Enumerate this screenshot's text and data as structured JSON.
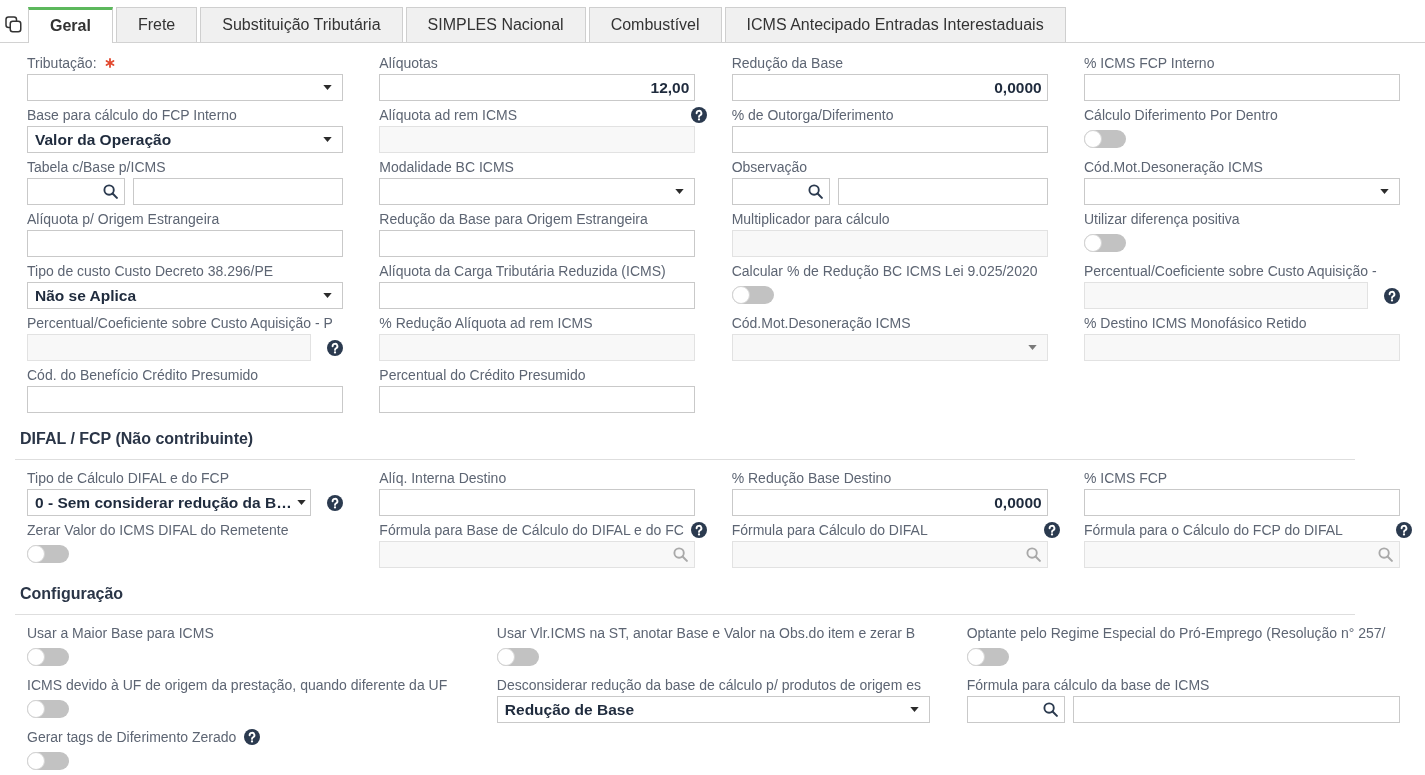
{
  "tabs": [
    {
      "label": "Geral",
      "selected": true
    },
    {
      "label": "Frete",
      "selected": false
    },
    {
      "label": "Substituição Tributária",
      "selected": false
    },
    {
      "label": "SIMPLES Nacional",
      "selected": false
    },
    {
      "label": "Combustível",
      "selected": false
    },
    {
      "label": "ICMS Antecipado Entradas Interestaduais",
      "selected": false
    }
  ],
  "fields": [
    {
      "label": "Tributação:",
      "kind": "select",
      "required": true,
      "disabled": false,
      "help": false
    },
    {
      "label": "Alíquotas",
      "kind": "text",
      "value": "12,00",
      "disabled": false,
      "help": false
    },
    {
      "label": "Redução da Base",
      "kind": "text",
      "value": "0,0000",
      "disabled": false,
      "help": false
    },
    {
      "label": "% ICMS FCP Interno",
      "kind": "text",
      "disabled": false,
      "help": false
    },
    {
      "label": "Base para cálculo do FCP Interno",
      "kind": "select",
      "value": "Valor da Operação",
      "disabled": false,
      "help": false
    },
    {
      "label": "Alíquota ad rem ICMS",
      "kind": "text",
      "disabled": true,
      "help": true
    },
    {
      "label": "% de Outorga/Diferimento",
      "kind": "text",
      "disabled": false,
      "help": false
    },
    {
      "label": "Cálculo Diferimento Por Dentro",
      "kind": "toggle",
      "on": false,
      "help": false
    },
    {
      "label": "Tabela c/Base p/ICMS",
      "kind": "lookup",
      "disabled": false,
      "help": false
    },
    {
      "label": "Modalidade BC ICMS",
      "kind": "select",
      "disabled": false,
      "help": false
    },
    {
      "label": "Observação",
      "kind": "lookup",
      "disabled": false,
      "help": false
    },
    {
      "label": "Cód.Mot.Desoneração ICMS",
      "kind": "select",
      "disabled": false,
      "help": false
    },
    {
      "label": "Alíquota p/ Origem Estrangeira",
      "kind": "text",
      "disabled": false,
      "help": false
    },
    {
      "label": "Redução da Base para Origem Estrangeira",
      "kind": "text",
      "disabled": false,
      "help": false
    },
    {
      "label": "Multiplicador para cálculo",
      "kind": "text",
      "disabled": true,
      "help": false
    },
    {
      "label": "Utilizar diferença positiva",
      "kind": "toggle",
      "on": false,
      "help": false
    },
    {
      "label": "Tipo de custo Custo Decreto 38.296/PE",
      "kind": "select",
      "value": "Não se Aplica",
      "disabled": false,
      "help": false
    },
    {
      "label": "Alíquota da Carga Tributária Reduzida (ICMS)",
      "kind": "text",
      "disabled": false,
      "help": false
    },
    {
      "label": "Calcular % de Redução BC ICMS Lei 9.025/2020",
      "kind": "toggle",
      "on": false,
      "help": false
    },
    {
      "label": "Percentual/Coeficiente sobre Custo Aquisição -",
      "kind": "text",
      "disabled": true,
      "help": true,
      "help_beside_field": true
    },
    {
      "label": "Percentual/Coeficiente sobre Custo Aquisição - P",
      "kind": "text",
      "disabled": true,
      "help": true,
      "help_beside_field": true
    },
    {
      "label": "% Redução Alíquota ad rem ICMS",
      "kind": "text",
      "disabled": true,
      "help": false
    },
    {
      "label": "Cód.Mot.Desoneração ICMS",
      "kind": "select",
      "disabled": true,
      "help": false
    },
    {
      "label": "% Destino ICMS Monofásico Retido",
      "kind": "text",
      "disabled": true,
      "help": false
    },
    {
      "label": "Cód. do Benefício Crédito Presumido",
      "kind": "text",
      "disabled": false,
      "help": false
    },
    {
      "label": "Percentual do Crédito Presumido",
      "kind": "text",
      "disabled": false,
      "help": false
    }
  ],
  "sections": [
    {
      "title": "DIFAL / FCP (Não contribuinte)",
      "kind": "narrow",
      "fields": [
        {
          "label": "Tipo de Cálculo DIFAL e do FCP",
          "kind": "select",
          "value": "0 - Sem considerar redução da B…",
          "disabled": false,
          "help": true,
          "help_beside_field": true
        },
        {
          "label": "Alíq. Interna Destino",
          "kind": "text",
          "disabled": false,
          "help": false
        },
        {
          "label": "% Redução Base Destino",
          "kind": "text",
          "value": "0,0000",
          "disabled": false,
          "help": false
        },
        {
          "label": "% ICMS FCP",
          "kind": "text",
          "disabled": false,
          "help": false
        },
        {
          "label": "Zerar Valor do ICMS DIFAL do Remetente",
          "kind": "toggle",
          "on": false,
          "help": false
        },
        {
          "label": "Fórmula para Base de Cálculo do DIFAL e do FC",
          "kind": "search",
          "disabled": true,
          "help": true
        },
        {
          "label": "Fórmula para Cálculo do DIFAL",
          "kind": "search",
          "disabled": true,
          "help": true
        },
        {
          "label": "Fórmula para o Cálculo do FCP do DIFAL",
          "kind": "search",
          "disabled": true,
          "help": true
        }
      ]
    },
    {
      "title": "Configuração",
      "kind": "wide",
      "fields": [
        {
          "label": "Usar a Maior Base para ICMS",
          "kind": "toggle",
          "on": false,
          "help": false
        },
        {
          "label": "Usar Vlr.ICMS na ST, anotar Base e Valor na Obs.do item e zerar B",
          "kind": "toggle",
          "on": false,
          "help": false
        },
        {
          "label": "Optante pelo Regime Especial do Pró-Emprego (Resolução n° 257/",
          "kind": "toggle",
          "on": false,
          "help": false
        },
        {
          "label": "ICMS devido à UF de origem da prestação, quando diferente da UF",
          "kind": "toggle",
          "on": false,
          "help": false
        },
        {
          "label": "Desconsiderar redução da base de cálculo p/ produtos de origem es",
          "kind": "select",
          "value": "Redução de Base",
          "disabled": false,
          "help": false
        },
        {
          "label": "Fórmula para cálculo da base de ICMS",
          "kind": "lookup",
          "disabled": false,
          "help": false
        },
        {
          "label": "Gerar tags de Diferimento Zerado",
          "kind": "toggle",
          "on": false,
          "help": true
        }
      ]
    }
  ]
}
